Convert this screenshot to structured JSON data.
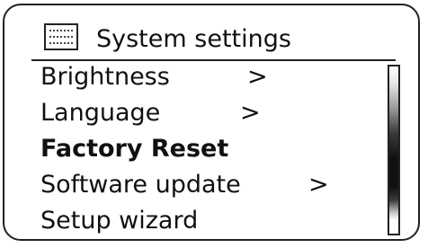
{
  "header": {
    "title": "System settings",
    "icon": "settings-screen-icon"
  },
  "menu": {
    "items": [
      {
        "label": "Brightness",
        "arrow": ">",
        "selected": false
      },
      {
        "label": "Language",
        "arrow": ">",
        "selected": false
      },
      {
        "label": "Factory Reset",
        "arrow": "",
        "selected": true
      },
      {
        "label": "Software update",
        "arrow": ">",
        "selected": false
      },
      {
        "label": "Setup wizard",
        "arrow": "",
        "selected": false
      }
    ]
  },
  "scrollbar": {
    "visible_fraction": 0.55
  },
  "colors": {
    "border": "#222222",
    "text": "#111111",
    "background": "#ffffff"
  }
}
